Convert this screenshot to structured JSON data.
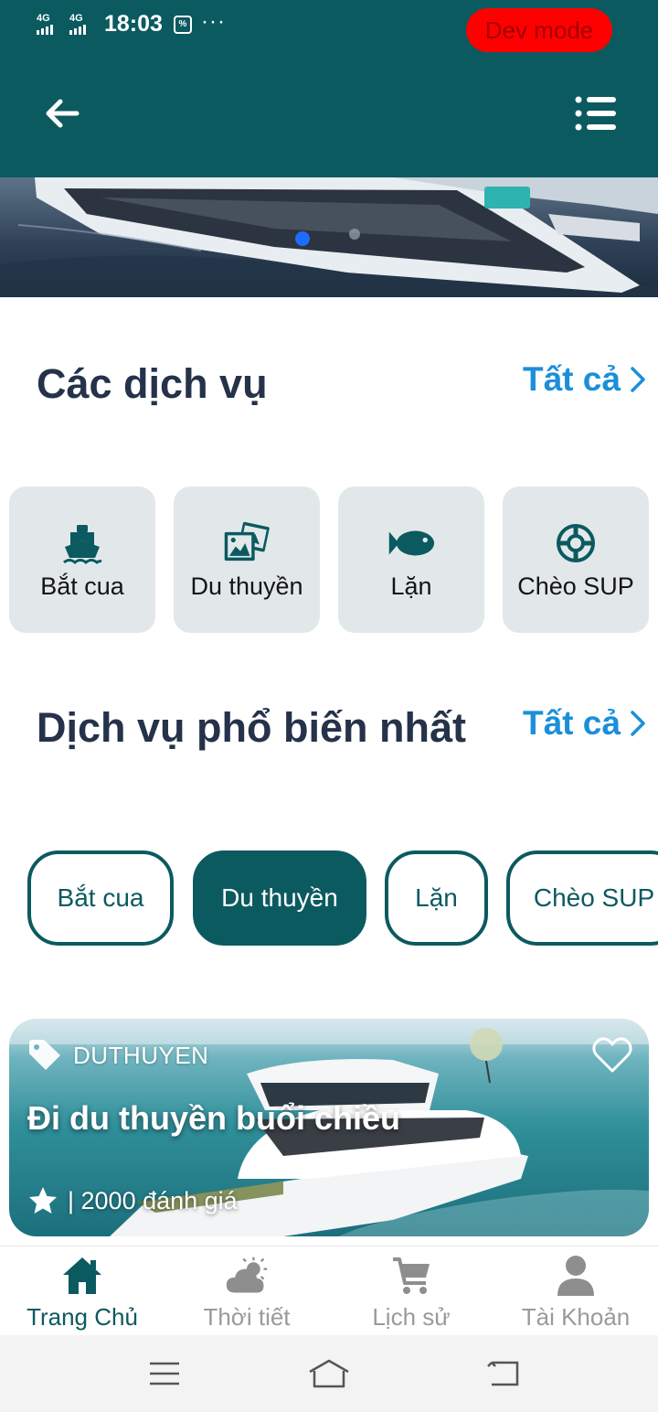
{
  "status_bar": {
    "network_1": "4G",
    "network_2": "4G",
    "time": "18:03",
    "dev_mode": "Dev mode"
  },
  "header": {
    "back_icon": "arrow-left-icon",
    "menu_icon": "list-icon",
    "color": "#0b5a60"
  },
  "banner": {
    "carousel_active_index": 0
  },
  "services": {
    "title": "Các dịch vụ",
    "see_all": "Tất cả",
    "items": [
      {
        "label": "Bắt cua",
        "icon": "ship-icon"
      },
      {
        "label": "Du thuyền",
        "icon": "images-icon"
      },
      {
        "label": "Lặn",
        "icon": "fish-icon"
      },
      {
        "label": "Chèo SUP",
        "icon": "lifebuoy-icon"
      }
    ]
  },
  "popular": {
    "title": "Dịch vụ phổ biến nhất",
    "see_all": "Tất cả",
    "chips": [
      {
        "label": "Bắt cua",
        "active": false
      },
      {
        "label": "Du thuyền",
        "active": true
      },
      {
        "label": "Lặn",
        "active": false
      },
      {
        "label": "Chèo SUP",
        "active": false
      }
    ],
    "featured": {
      "tag": "DUTHUYEN",
      "title": "Đi du thuyền buổi chiều",
      "rating_text": "| 2000 đánh giá",
      "favorite": false
    }
  },
  "bottom_nav": {
    "items": [
      {
        "label": "Trang Chủ",
        "icon": "home-icon",
        "active": true
      },
      {
        "label": "Thời tiết",
        "icon": "cloud-sun-icon",
        "active": false
      },
      {
        "label": "Lịch sử",
        "icon": "cart-icon",
        "active": false
      },
      {
        "label": "Tài Khoản",
        "icon": "user-icon",
        "active": false
      }
    ]
  },
  "colors": {
    "primary": "#0b5a60",
    "link": "#1b8fd9",
    "title": "#25324a",
    "dev_mode_bg": "#ff0000"
  }
}
